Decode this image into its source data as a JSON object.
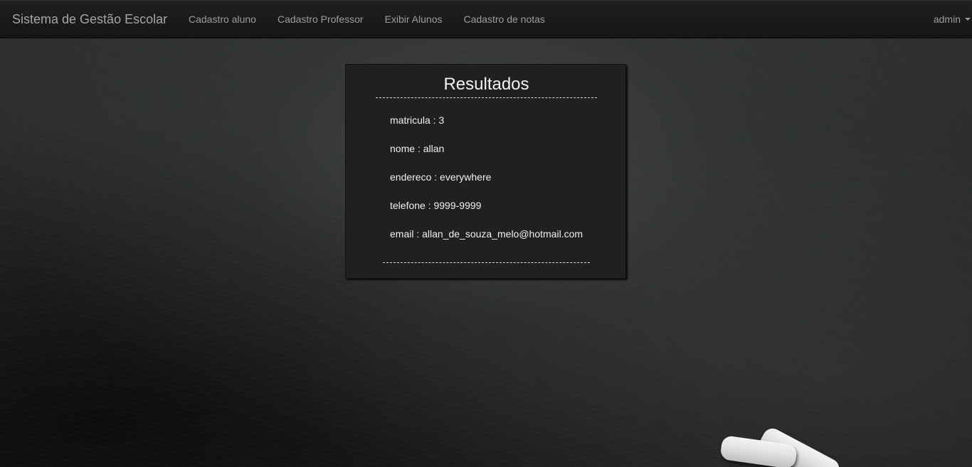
{
  "navbar": {
    "brand": "Sistema de Gestão Escolar",
    "links": [
      {
        "label": "Cadastro aluno"
      },
      {
        "label": "Cadastro Professor"
      },
      {
        "label": "Exibir Alunos"
      },
      {
        "label": "Cadastro de notas"
      }
    ],
    "user": "admin"
  },
  "results": {
    "title": "Resultados",
    "fields": [
      {
        "text": "matricula : 3"
      },
      {
        "text": "nome : allan"
      },
      {
        "text": "endereco : everywhere"
      },
      {
        "text": "telefone : 9999-9999"
      },
      {
        "text": "email : allan_de_souza_melo@hotmail.com"
      }
    ]
  },
  "colors": {
    "navbar_bg": "#161717",
    "panel_bg": "#202020",
    "text_light": "#f0f0f0",
    "nav_text": "#9d9d9d"
  }
}
